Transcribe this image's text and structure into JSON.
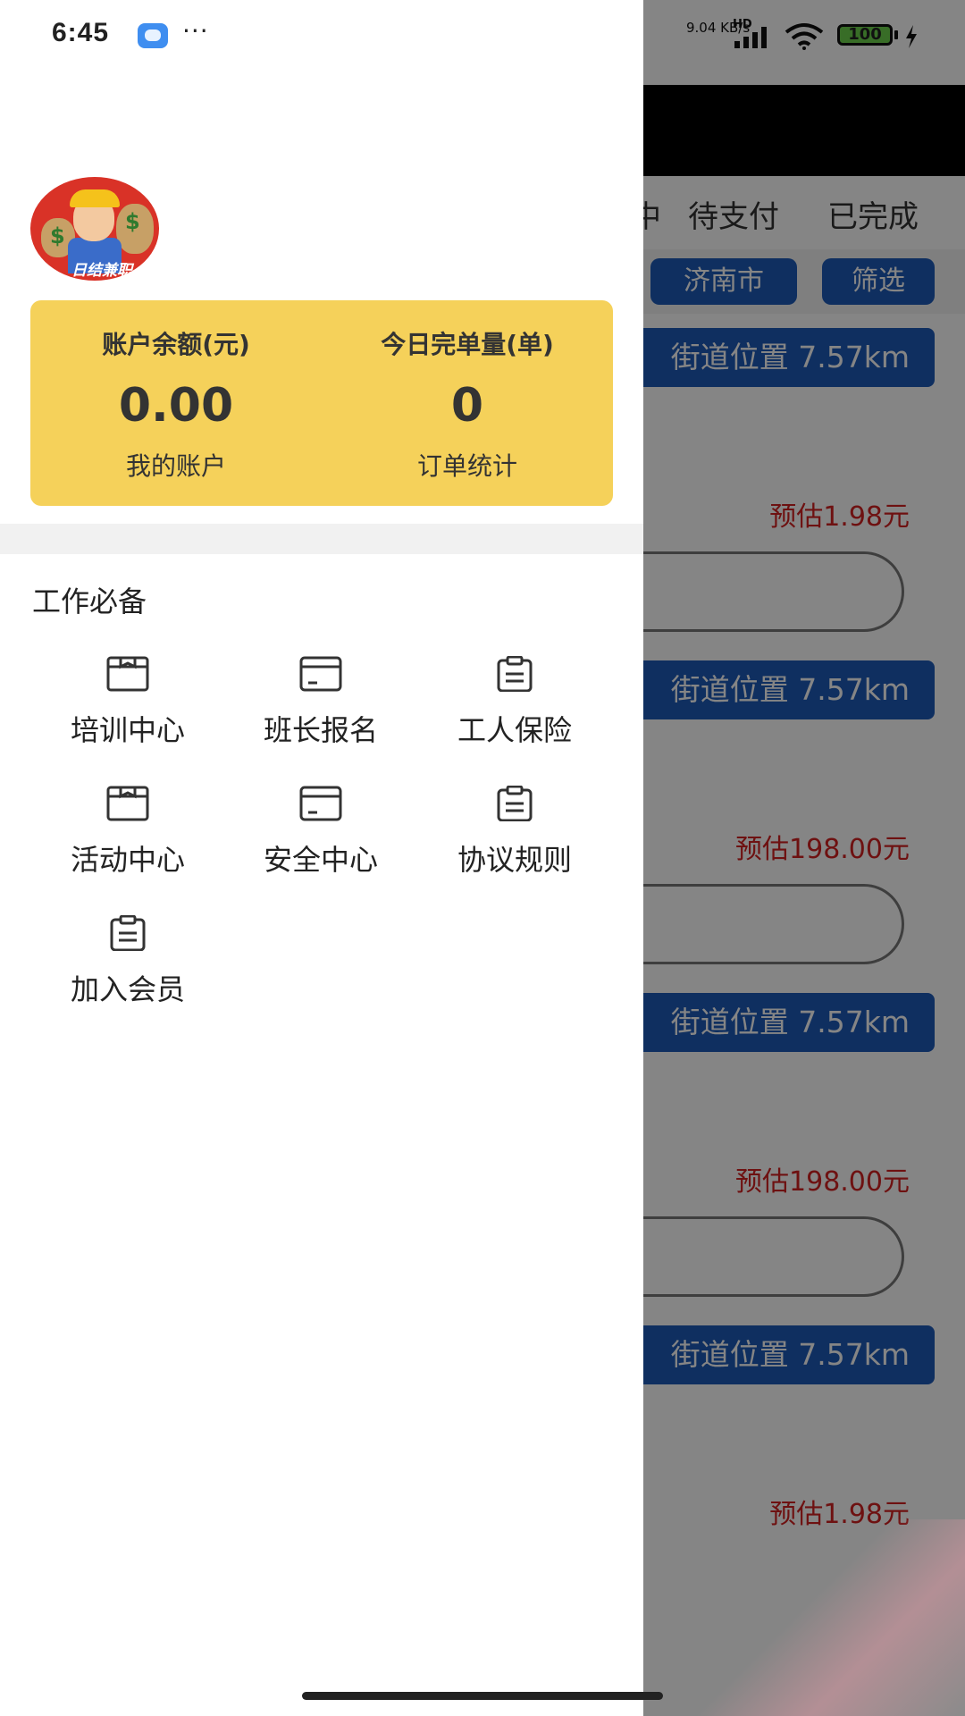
{
  "status_bar": {
    "time": "6:45",
    "dots": "···",
    "net_speed": "9.04 KB/s",
    "signal": "HD",
    "battery": "100"
  },
  "background": {
    "tabs": [
      "中",
      "待支付",
      "已完成"
    ],
    "filters": {
      "city": "济南市",
      "filter": "筛选"
    },
    "orders": [
      {
        "location": "街道位置 7.57km",
        "price": "预估1.98元"
      },
      {
        "location": "街道位置 7.57km",
        "price": "预估198.00元"
      },
      {
        "location": "街道位置 7.57km",
        "price": "预估198.00元"
      },
      {
        "location": "街道位置 7.57km",
        "price": "预估1.98元"
      }
    ]
  },
  "drawer": {
    "avatar_banner": "日结兼职",
    "account": {
      "balance_label": "账户余额(元)",
      "balance_value": "0.00",
      "balance_link": "我的账户",
      "orders_label": "今日完单量(单)",
      "orders_value": "0",
      "orders_link": "订单统计"
    },
    "section_title": "工作必备",
    "items": [
      {
        "label": "培训中心",
        "icon": "box-icon"
      },
      {
        "label": "班长报名",
        "icon": "card-icon"
      },
      {
        "label": "工人保险",
        "icon": "clipboard-icon"
      },
      {
        "label": "活动中心",
        "icon": "box-icon"
      },
      {
        "label": "安全中心",
        "icon": "card-icon"
      },
      {
        "label": "协议规则",
        "icon": "clipboard-icon"
      },
      {
        "label": "加入会员",
        "icon": "clipboard-icon"
      }
    ]
  },
  "colors": {
    "accent_yellow": "#f5d15a",
    "brand_blue": "#1e5bb8",
    "price_red": "#d32121"
  }
}
